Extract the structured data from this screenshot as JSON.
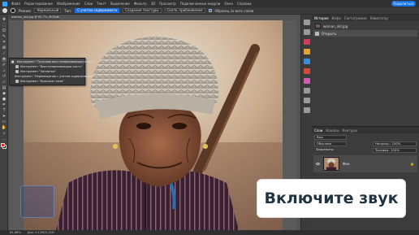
{
  "menu": {
    "items": [
      "Файл",
      "Редактирование",
      "Изображение",
      "Слои",
      "Текст",
      "Выделение",
      "Фильтр",
      "3D",
      "Просмотр",
      "Подключаемые модули",
      "Окно",
      "Справка"
    ],
    "share_label": "Поделиться"
  },
  "options": {
    "mode_label": "Режим:",
    "mode_value": "Нормальный",
    "type_label": "Тип:",
    "type_option_content": "С учетом содержимого",
    "type_option_texture": "Создание текстуры",
    "type_option_approx": "Соотв. приближения",
    "sample_all_layers": "Образец со всех слоев"
  },
  "document": {
    "tab_label": "woman_old.jpg @ 65,7% (RGB/8)",
    "close_glyph": "×"
  },
  "flyout": {
    "items": [
      {
        "label": "Инструмент \"Точечная восстанавливающая кисть\"",
        "selected": true
      },
      {
        "label": "Инструмент \"Восстанавливающая кисть\"",
        "selected": false
      },
      {
        "label": "Инструмент \"Заплатка\"",
        "selected": false
      },
      {
        "label": "Инструмент \"Перемещение с учетом содержимого\"",
        "selected": false
      },
      {
        "label": "Инструмент \"Красные глаза\"",
        "selected": false
      }
    ]
  },
  "panels": {
    "top_tabs": [
      "История",
      "Инфо",
      "Гистограмма",
      "Навигатор"
    ],
    "history_items": [
      "woman_old.jpg",
      "Открыть"
    ],
    "layers_tabs": [
      "Слои",
      "Каналы",
      "Контуры"
    ],
    "blend_mode": "Обычные",
    "kind_filter": "Вид",
    "opacity": "Непрозр.: 100%",
    "fill": "Заливка: 100%",
    "lock_label": "Закрепить:",
    "layer_name": "Фон",
    "lock_glyph": "🔒"
  },
  "overlay": {
    "sound_text": "Включите звук"
  },
  "status": {
    "zoom": "65,68%",
    "doc_size": "Док: 9,12M/9,12M"
  },
  "colors": {
    "accent": "#1473e6",
    "foreground_swatch": "#e0281f",
    "background_swatch": "#111111"
  }
}
